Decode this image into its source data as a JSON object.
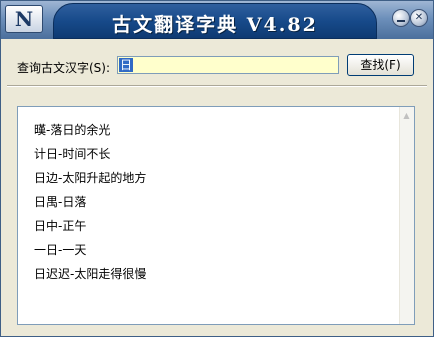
{
  "window": {
    "title": "古文翻译字典  V4.82",
    "logo_letter": "N",
    "minimize_icon": "minimize-icon",
    "close_icon": "close-icon"
  },
  "search": {
    "label": "查询古文汉字(S):",
    "value": "日",
    "button_label": "查找(F)"
  },
  "results": {
    "items": [
      "暵-落日的余光",
      "计日-时间不长",
      "日边-太阳升起的地方",
      "日禺-日落",
      "日中-正午",
      "一日-一天",
      "日迟迟-太阳走得很慢"
    ]
  },
  "colors": {
    "title_bar": "#174a8a",
    "input_bg": "#ffffcc",
    "window_bg": "#ece9d8"
  }
}
